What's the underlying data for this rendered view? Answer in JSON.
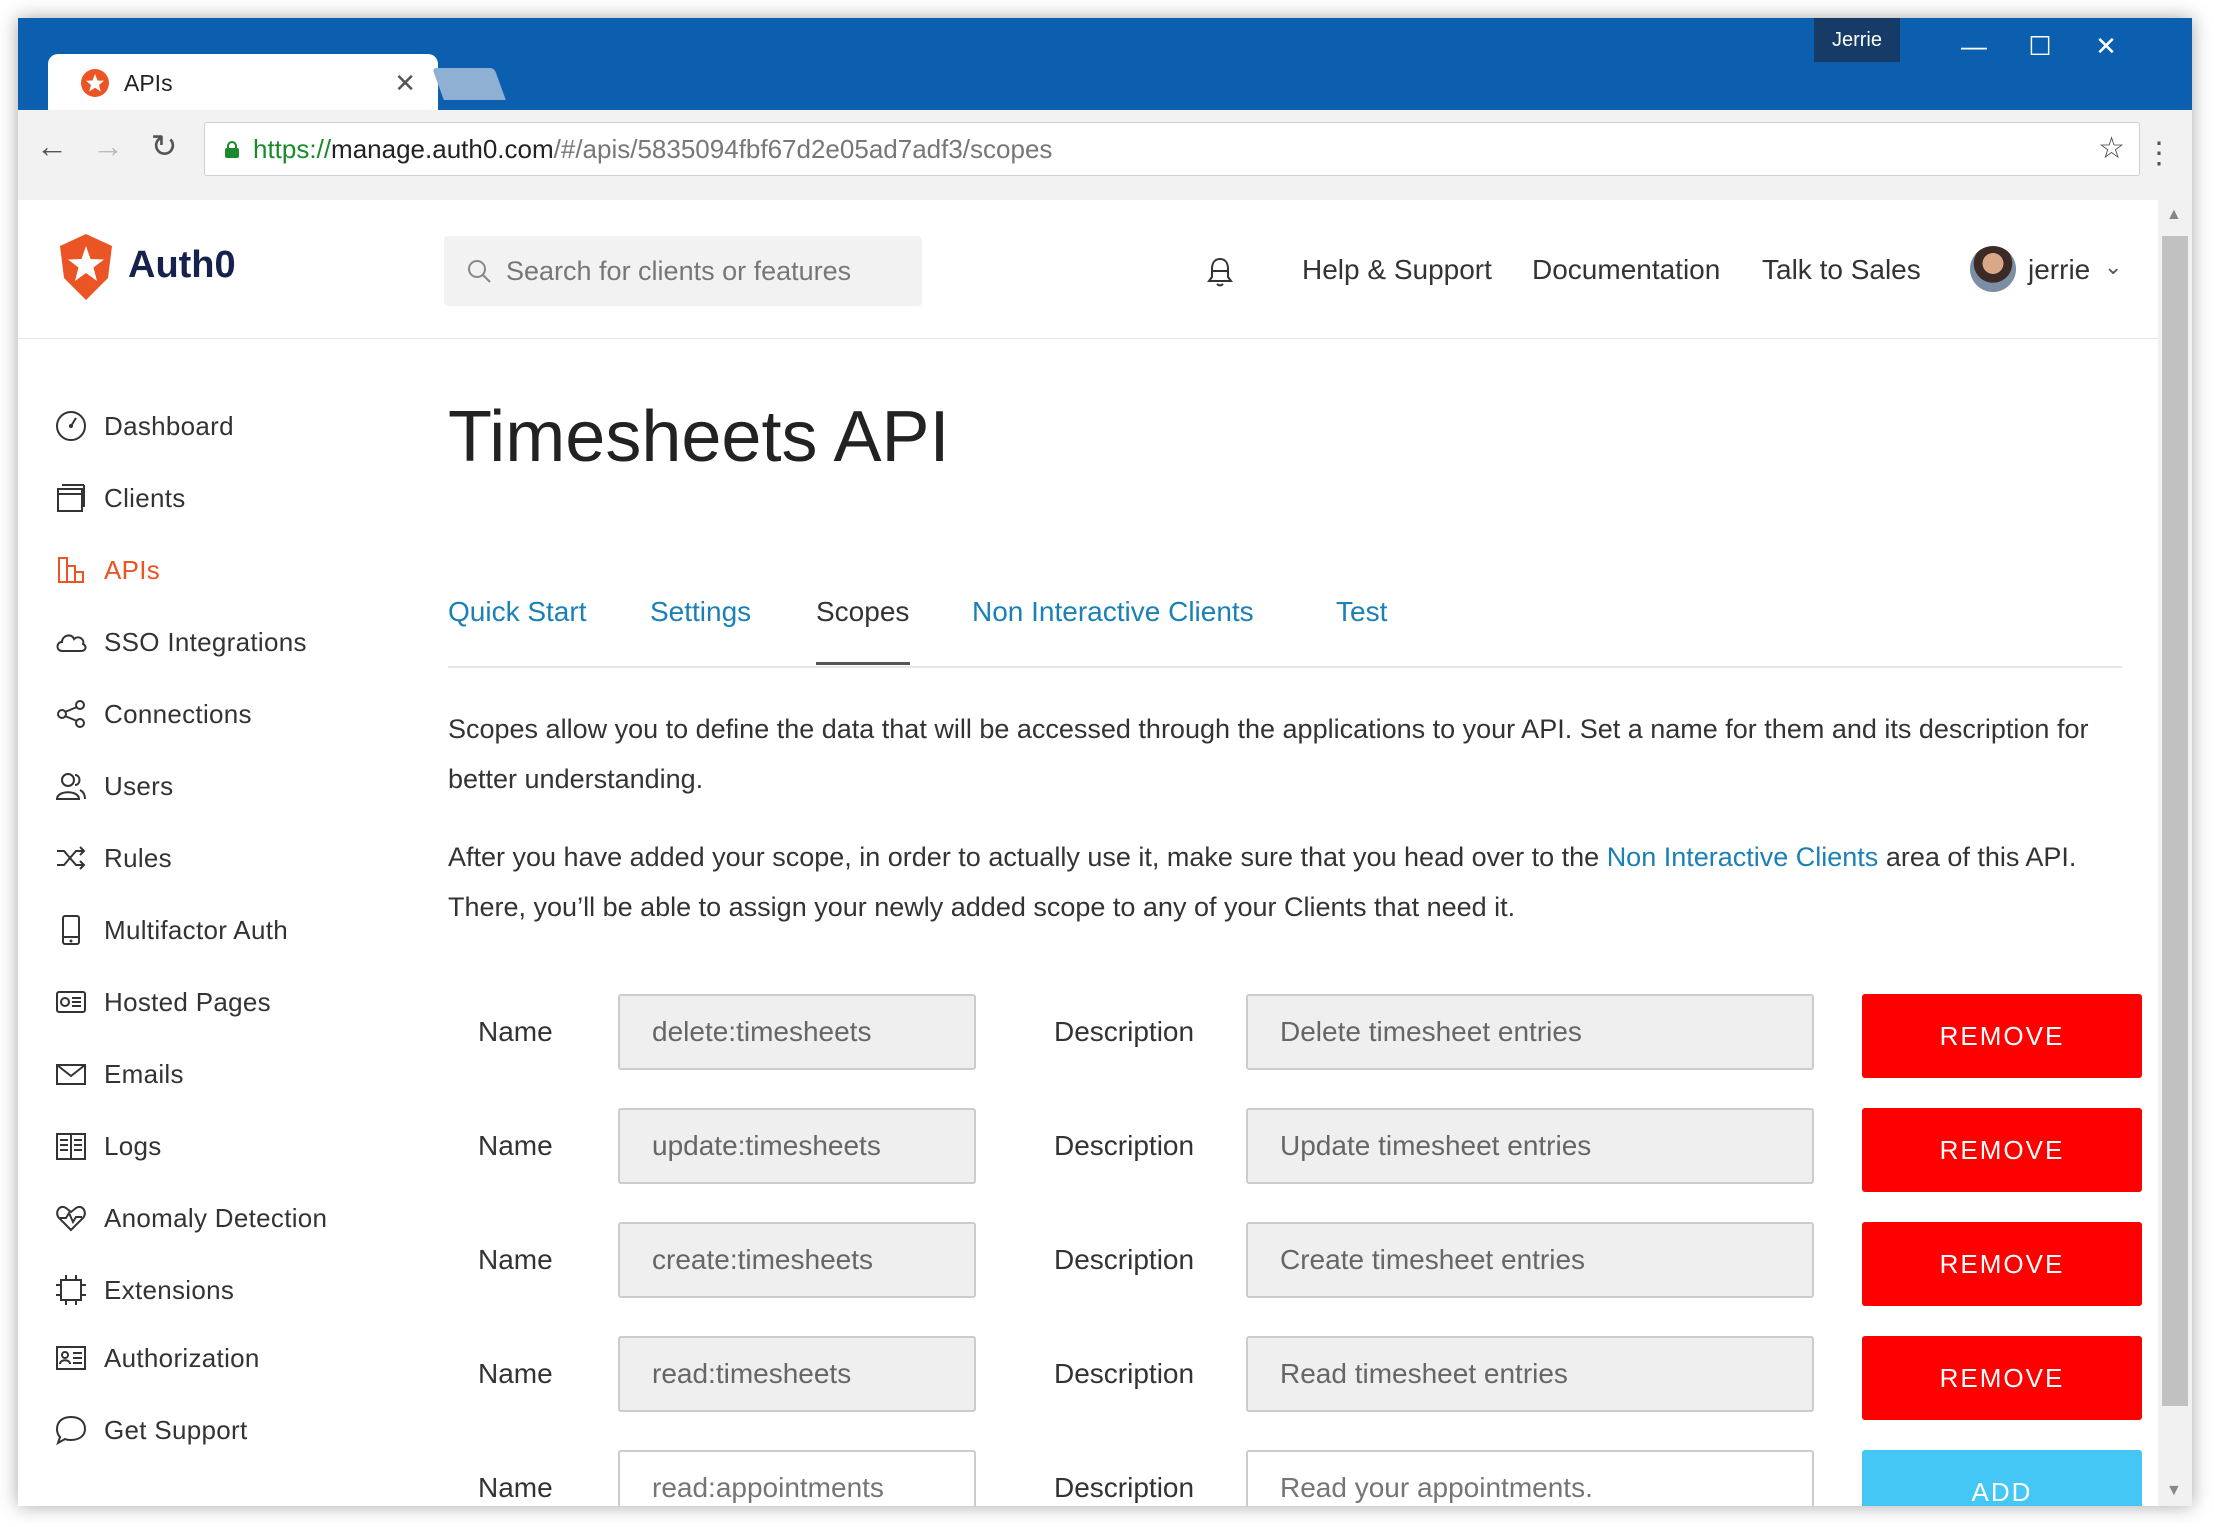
{
  "browser": {
    "tab_title": "APIs",
    "profile_name": "Jerrie",
    "url_scheme": "https://",
    "url_host": "manage.auth0.com",
    "url_path": "/#/apis/5835094fbf67d2e05ad7adf3/scopes"
  },
  "header": {
    "brand": "Auth0",
    "search_placeholder": "Search for clients or features",
    "nav": [
      "Help & Support",
      "Documentation",
      "Talk to Sales"
    ],
    "username": "jerrie"
  },
  "sidebar": {
    "items": [
      {
        "label": "Dashboard",
        "icon": "dashboard-icon"
      },
      {
        "label": "Clients",
        "icon": "clients-icon"
      },
      {
        "label": "APIs",
        "icon": "apis-icon",
        "active": true
      },
      {
        "label": "SSO Integrations",
        "icon": "cloud-icon"
      },
      {
        "label": "Connections",
        "icon": "share-icon"
      },
      {
        "label": "Users",
        "icon": "users-icon"
      },
      {
        "label": "Rules",
        "icon": "shuffle-icon"
      },
      {
        "label": "Multifactor Auth",
        "icon": "phone-icon"
      },
      {
        "label": "Hosted Pages",
        "icon": "hosted-pages-icon"
      },
      {
        "label": "Emails",
        "icon": "envelope-icon"
      },
      {
        "label": "Logs",
        "icon": "book-icon"
      },
      {
        "label": "Anomaly Detection",
        "icon": "heart-pulse-icon"
      },
      {
        "label": "Extensions",
        "icon": "chip-icon"
      },
      {
        "label": "Authorization",
        "icon": "id-card-icon"
      },
      {
        "label": "Get Support",
        "icon": "chat-bubble-icon"
      }
    ],
    "active_color": "#eb5424"
  },
  "main": {
    "title": "Timesheets API",
    "tabs": [
      {
        "label": "Quick Start"
      },
      {
        "label": "Settings"
      },
      {
        "label": "Scopes",
        "active": true
      },
      {
        "label": "Non Interactive Clients"
      },
      {
        "label": "Test"
      }
    ],
    "intro_1": "Scopes allow you to define the data that will be accessed through the applications to your API. Set a name for them and its description for better understanding.",
    "intro_2_before": "After you have added your scope, in order to actually use it, make sure that you head over to the ",
    "intro_2_link": "Non Interactive Clients",
    "intro_2_after": " area of this API. There, you’ll be able to assign your newly added scope to any of your Clients that need it.",
    "name_label": "Name",
    "description_label": "Description",
    "scopes": [
      {
        "name": "delete:timesheets",
        "description": "Delete timesheet entries",
        "button": "REMOVE"
      },
      {
        "name": "update:timesheets",
        "description": "Update timesheet entries",
        "button": "REMOVE"
      },
      {
        "name": "create:timesheets",
        "description": "Create timesheet entries",
        "button": "REMOVE"
      },
      {
        "name": "read:timesheets",
        "description": "Read timesheet entries",
        "button": "REMOVE"
      }
    ],
    "new_scope": {
      "name_placeholder": "read:appointments",
      "description_placeholder": "Read your appointments.",
      "button": "ADD"
    },
    "colors": {
      "remove": "#ff0000",
      "add": "#44c7f4",
      "link": "#1a80b6"
    }
  }
}
